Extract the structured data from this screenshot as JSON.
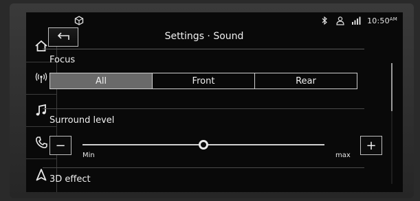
{
  "status": {
    "time": "10:50",
    "ampm": "AM",
    "icons": [
      "settings-cube-icon",
      "bluetooth-icon",
      "user-profile-icon",
      "signal-icon"
    ]
  },
  "sidebar": {
    "items": [
      {
        "name": "home",
        "icon": "home-icon"
      },
      {
        "name": "radio",
        "icon": "radio-broadcast-icon"
      },
      {
        "name": "media",
        "icon": "music-note-icon"
      },
      {
        "name": "phone",
        "icon": "phone-icon"
      },
      {
        "name": "navigation",
        "icon": "navigation-arrow-icon"
      }
    ]
  },
  "header": {
    "title": "Settings · Sound",
    "back_icon": "back-arrow-icon"
  },
  "focus": {
    "label": "Focus",
    "options": [
      "All",
      "Front",
      "Rear"
    ],
    "selected": "All"
  },
  "surround": {
    "label": "Surround level",
    "min_label": "Min",
    "max_label": "max",
    "value_fraction": 0.5,
    "minus_label": "−",
    "plus_label": "+"
  },
  "effect": {
    "label": "3D effect"
  },
  "colors": {
    "screen_bg": "#090909",
    "active_segment": "#6a6a6a",
    "text": "#f0f0f0"
  }
}
